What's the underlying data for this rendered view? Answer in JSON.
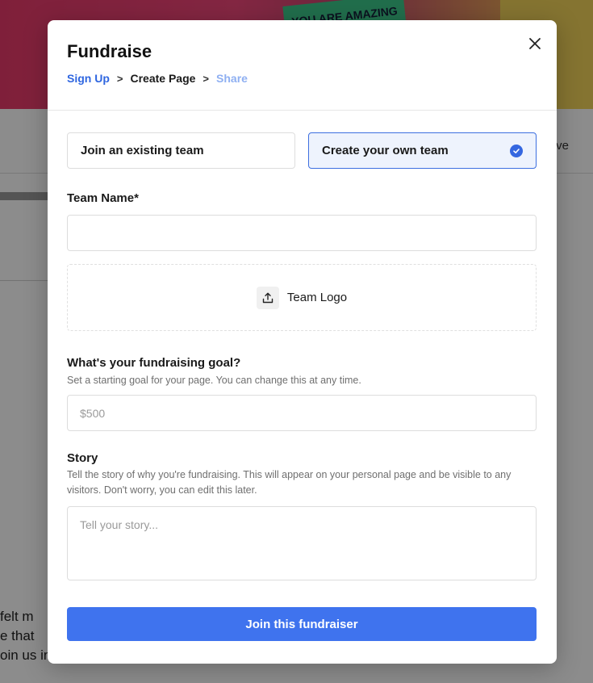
{
  "background": {
    "sticker_text": "YOU ARE AMAZING",
    "row_right_text": "ve",
    "body_lines": [
      "felt m",
      "e that",
      "oin us in making this vision a reality."
    ]
  },
  "modal": {
    "title": "Fundraise",
    "breadcrumb": {
      "step1": "Sign Up",
      "step2": "Create Page",
      "step3": "Share",
      "separator": ">"
    },
    "close_icon": "close-icon"
  },
  "team_choice": {
    "existing_label": "Join an existing team",
    "create_label": "Create your own team",
    "selected": "create"
  },
  "team_name": {
    "label": "Team Name*",
    "value": "",
    "placeholder": ""
  },
  "team_logo": {
    "label": "Team Logo",
    "icon": "upload-icon"
  },
  "goal": {
    "label": "What's your fundraising goal?",
    "help": "Set a starting goal for your page. You can change this at any time.",
    "placeholder": "$500",
    "value": ""
  },
  "story": {
    "label": "Story",
    "help": "Tell the story of why you're fundraising. This will appear on your personal page and be visible to any visitors. Don't worry, you can edit this later.",
    "placeholder": "Tell your story...",
    "value": ""
  },
  "submit_label": "Join this fundraiser",
  "colors": {
    "accent": "#3f73ee",
    "breadcrumb_active": "#2f66e0",
    "breadcrumb_upcoming": "#8fb0f2",
    "selected_bg": "#eef3fd"
  }
}
